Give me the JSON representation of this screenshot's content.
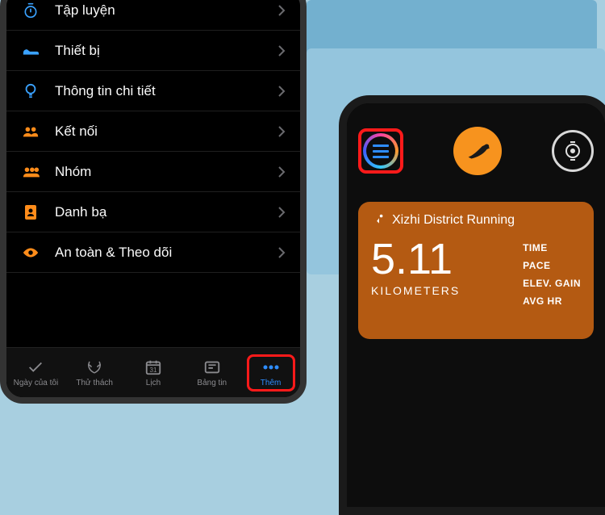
{
  "left": {
    "menu": [
      {
        "icon": "stopwatch",
        "color": "blue",
        "label": "Tập luyện"
      },
      {
        "icon": "shoe",
        "color": "blue",
        "label": "Thiết bị"
      },
      {
        "icon": "bulb",
        "color": "blue",
        "label": "Thông tin chi tiết"
      },
      {
        "icon": "group",
        "color": "orange",
        "label": "Kết nối"
      },
      {
        "icon": "group",
        "color": "orange",
        "label": "Nhóm"
      },
      {
        "icon": "contacts",
        "color": "orange",
        "label": "Danh bạ"
      },
      {
        "icon": "eye",
        "color": "orange",
        "label": "An toàn & Theo dõi"
      }
    ],
    "tabs": [
      {
        "id": "day",
        "label": "Ngày của tôi"
      },
      {
        "id": "challenge",
        "label": "Thử thách"
      },
      {
        "id": "calendar",
        "label": "Lịch",
        "badge": "31"
      },
      {
        "id": "news",
        "label": "Bảng tin"
      },
      {
        "id": "more",
        "label": "Thêm",
        "active": true,
        "highlighted": true
      }
    ]
  },
  "right": {
    "card": {
      "title": "Xizhi District Running",
      "metric_value": "5.11",
      "metric_unit": "KILOMETERS",
      "stats": [
        "TIME",
        "PACE",
        "ELEV. GAIN",
        "AVG HR"
      ]
    }
  }
}
